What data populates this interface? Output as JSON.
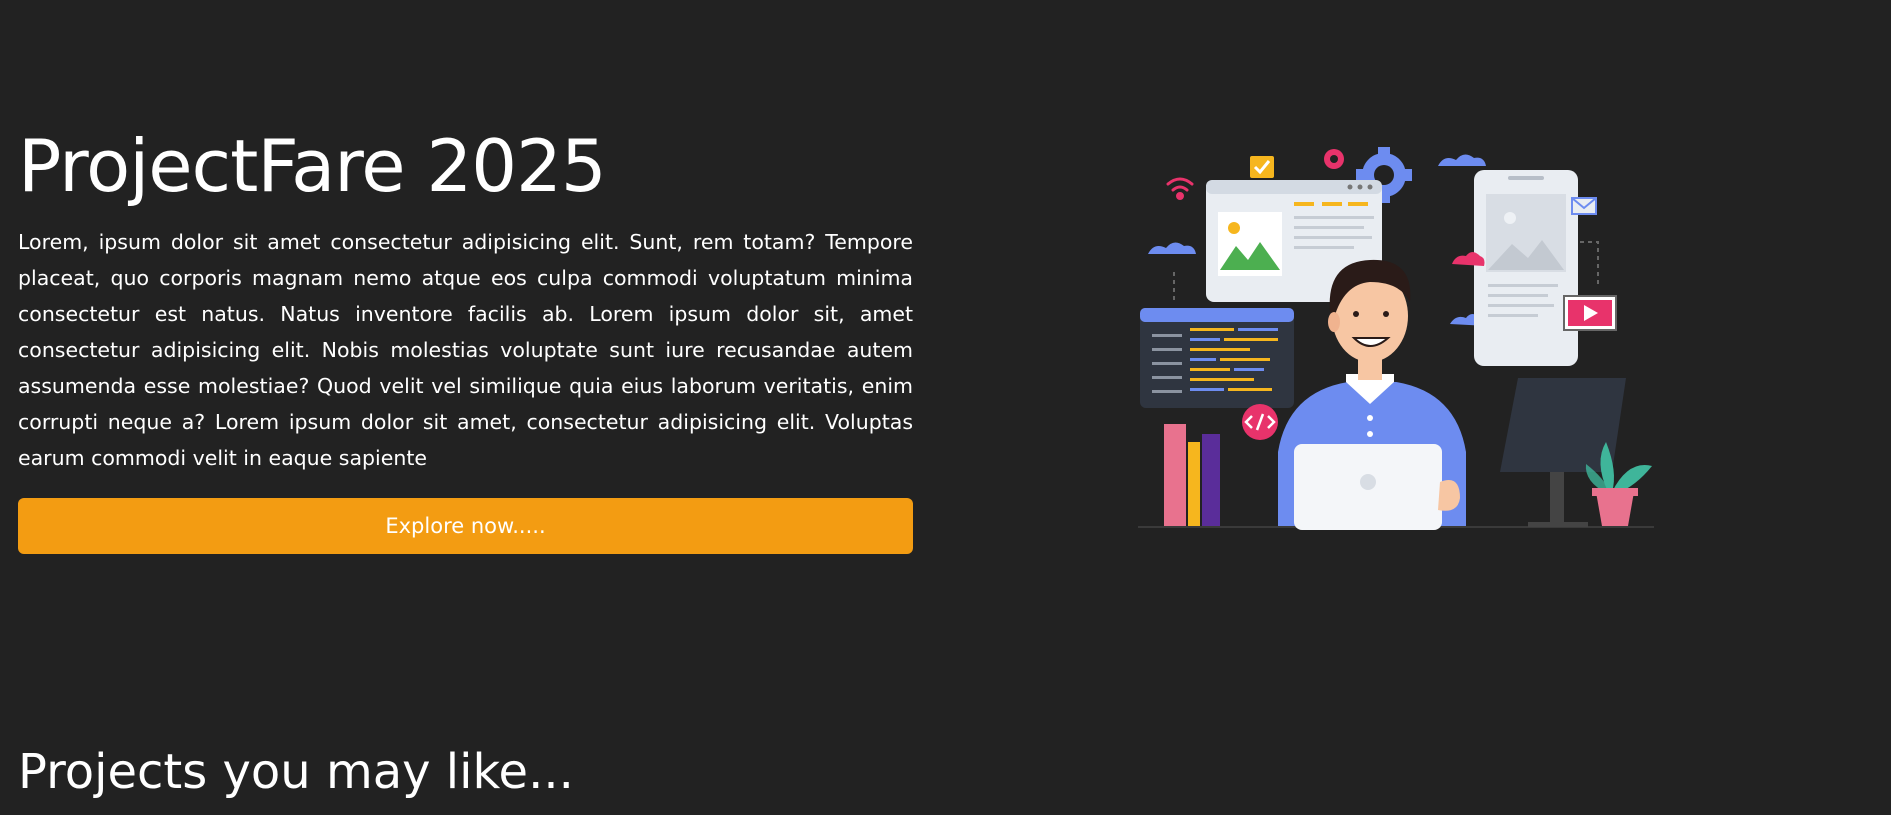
{
  "hero": {
    "title": "ProjectFare 2025",
    "description": "Lorem, ipsum dolor sit amet consectetur adipisicing elit. Sunt, rem totam? Tempore placeat, quo corporis magnam nemo atque eos culpa commodi voluptatum minima consectetur est natus. Natus inventore facilis ab. Lorem ipsum dolor sit, amet consectetur adipisicing elit. Nobis molestias voluptate sunt iure recusandae autem assumenda esse molestiae? Quod velit vel similique quia eius laborum veritatis, enim corrupti neque a? Lorem ipsum dolor sit amet, consectetur adipisicing elit. Voluptas earum commodi velit in eaque sapiente",
    "button_label": "Explore now.....",
    "accent_color": "#f39c12"
  },
  "section": {
    "title": "Projects you may like..."
  },
  "colors": {
    "background": "#222222",
    "text": "#ffffff"
  },
  "illustration": {
    "icon": "developer-at-laptop-illustration"
  }
}
